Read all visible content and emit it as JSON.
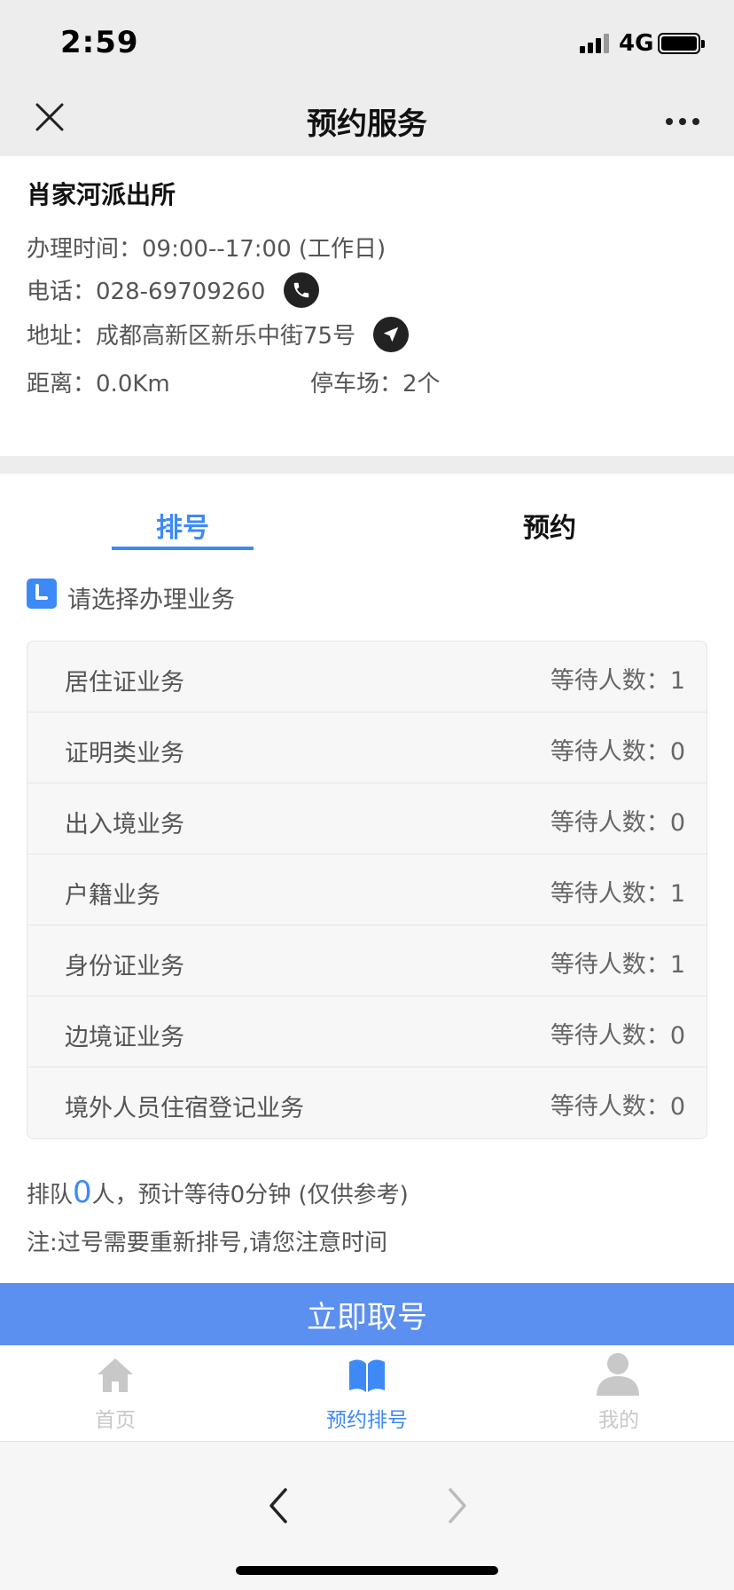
{
  "status_bar": {
    "time": "2:59",
    "network": "4G"
  },
  "nav": {
    "title": "预约服务"
  },
  "station": {
    "name": "肖家河派出所",
    "hours_label": "办理时间：",
    "hours": "09:00--17:00 (工作日)",
    "phone_label": "电话：",
    "phone": "028-69709260",
    "address_label": "地址：",
    "address": "成都高新区新乐中街75号",
    "distance_label": "距离：",
    "distance": "0.0Km",
    "parking_label": "停车场：",
    "parking": "2个"
  },
  "tabs": {
    "queue": "排号",
    "appointment": "预约"
  },
  "section": {
    "label": "请选择办理业务"
  },
  "wait_label": "等待人数：",
  "businesses": [
    {
      "name": "居住证业务",
      "waiting": "1"
    },
    {
      "name": "证明类业务",
      "waiting": "0"
    },
    {
      "name": "出入境业务",
      "waiting": "0"
    },
    {
      "name": "户籍业务",
      "waiting": "1"
    },
    {
      "name": "身份证业务",
      "waiting": "1"
    },
    {
      "name": "边境证业务",
      "waiting": "0"
    },
    {
      "name": "境外人员住宿登记业务",
      "waiting": "0"
    }
  ],
  "queue": {
    "prefix": "排队",
    "count": "0",
    "suffix": "人，预计等待0分钟 (仅供参考)",
    "note": "注:过号需要重新排号,请您注意时间"
  },
  "take_button": "立即取号",
  "tabbar": {
    "home": "首页",
    "booking": "预约排号",
    "me": "我的",
    "active_color": "#3d8af7",
    "inactive_color": "#c8c8c8"
  }
}
